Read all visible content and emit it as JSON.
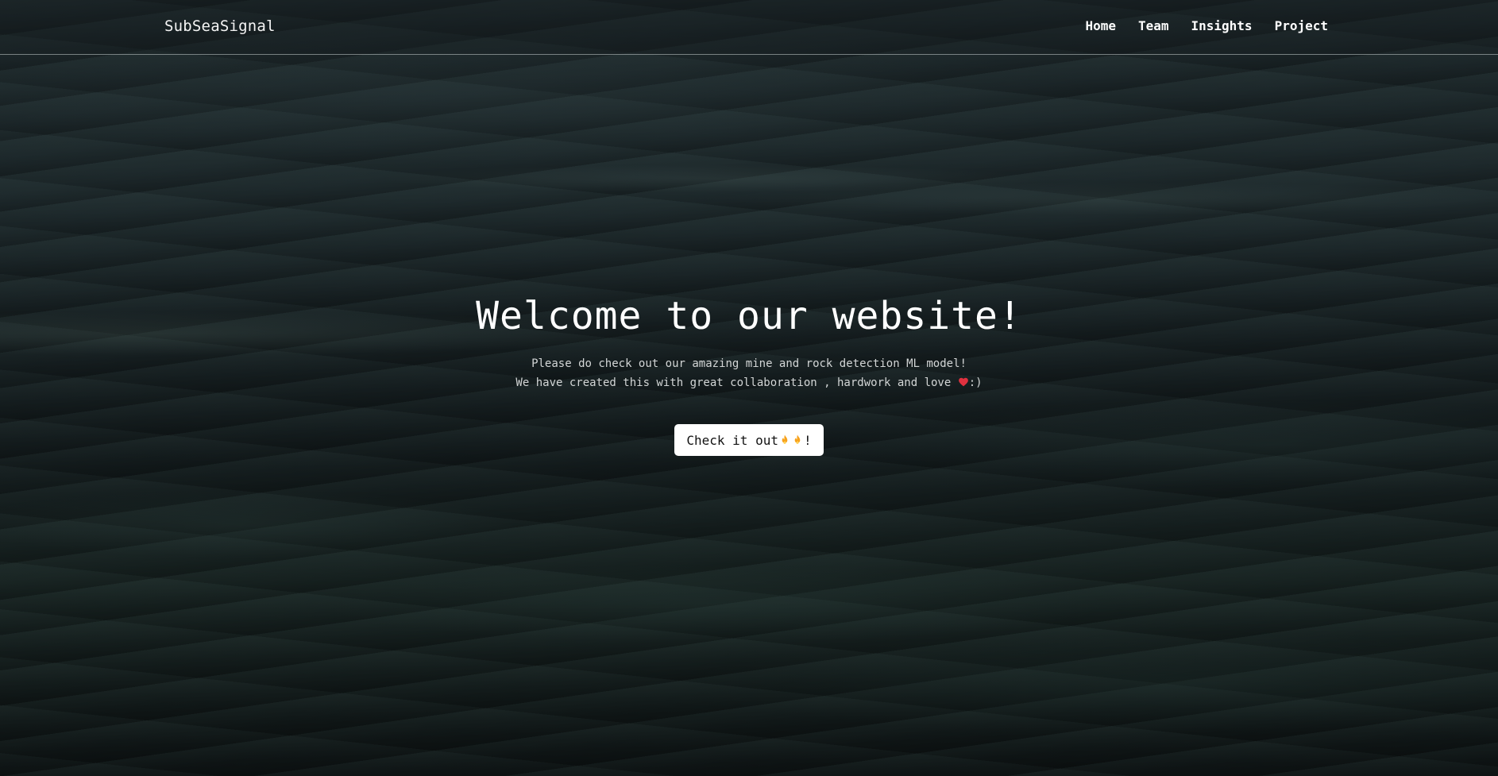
{
  "navbar": {
    "brand": "SubSeaSignal",
    "links": [
      {
        "label": "Home"
      },
      {
        "label": "Team"
      },
      {
        "label": "Insights"
      },
      {
        "label": "Project"
      }
    ]
  },
  "hero": {
    "title": "Welcome to our website!",
    "line1": "Please do check out our amazing mine and rock detection ML model!",
    "line2_prefix": "We have created this with great collaboration , hardwork and love ",
    "line2_suffix": ":)",
    "heart_icon": "red-heart-icon",
    "cta": {
      "label": "Check it out",
      "suffix": "!",
      "icons": [
        "fire-icon",
        "fire-icon"
      ]
    }
  },
  "colors": {
    "navbar_border": "#c8d2d2",
    "button_bg": "#ffffff",
    "heart": "#e0313f",
    "fire": "#f7a21b"
  }
}
